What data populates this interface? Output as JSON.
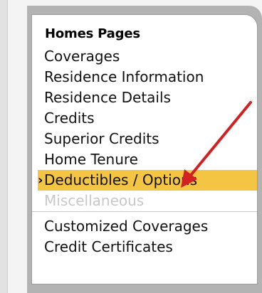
{
  "menu": {
    "title": "Homes Pages",
    "items": [
      {
        "label": "Coverages",
        "state": "normal"
      },
      {
        "label": "Residence Information",
        "state": "normal"
      },
      {
        "label": "Residence Details",
        "state": "normal"
      },
      {
        "label": "Credits",
        "state": "normal"
      },
      {
        "label": "Superior Credits",
        "state": "normal"
      },
      {
        "label": "Home Tenure",
        "state": "normal"
      },
      {
        "label": "Deductibles / Options",
        "state": "selected"
      },
      {
        "label": "Miscellaneous",
        "state": "disabled"
      },
      {
        "label": "Customized Coverages",
        "state": "normal"
      },
      {
        "label": "Credit Certificates",
        "state": "normal"
      }
    ],
    "selected_marker": "›"
  },
  "colors": {
    "selected_bg": "#f4c542",
    "disabled_text": "#c8c8c8",
    "annotation_arrow": "#d32020"
  },
  "annotation": {
    "icon": "red-arrow-icon"
  }
}
